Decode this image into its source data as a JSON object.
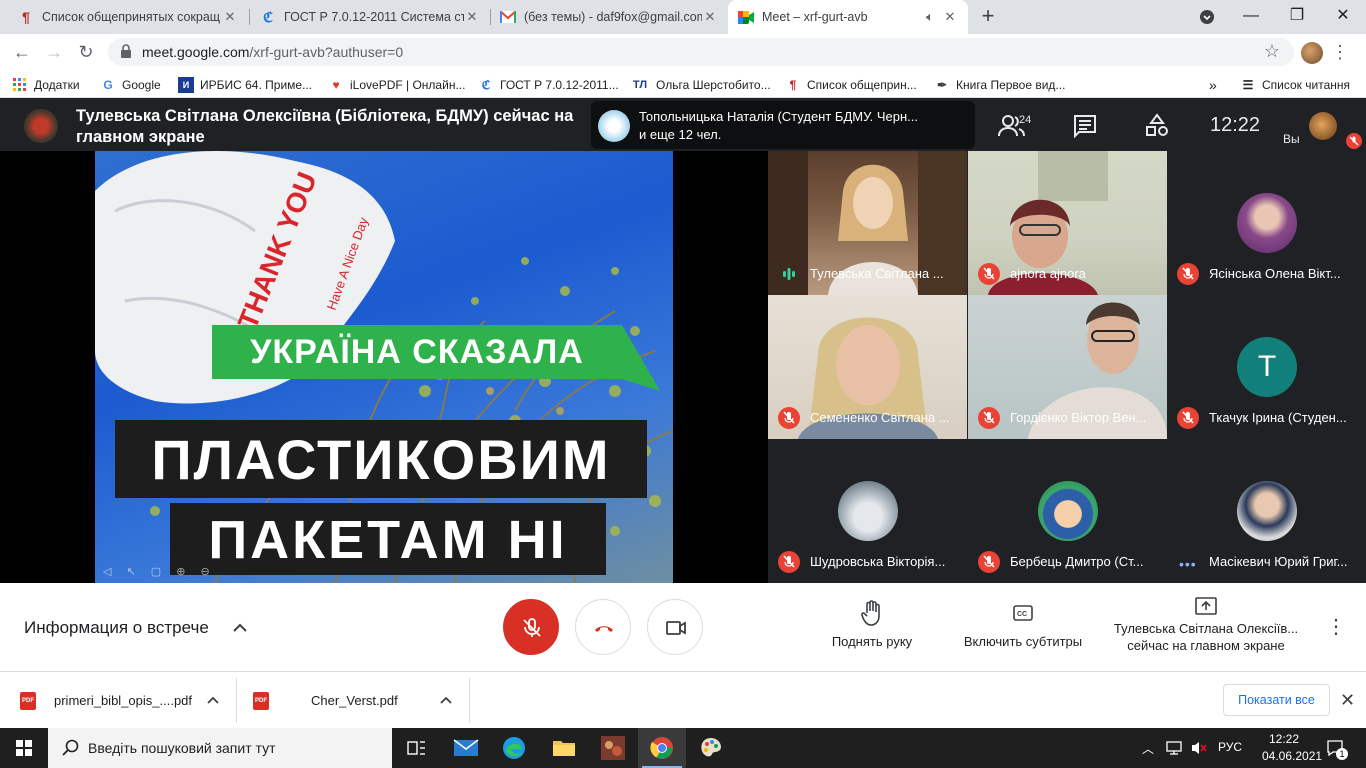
{
  "browser": {
    "tabs": [
      {
        "title": "Список общепринятых сокращ",
        "icon": "pilcrow-icon",
        "active": false
      },
      {
        "title": "ГОСТ Р 7.0.12-2011 Система ста",
        "icon": "gost-site-icon",
        "active": false
      },
      {
        "title": "(без темы) - daf9fox@gmail.com",
        "icon": "gmail-icon",
        "active": false
      },
      {
        "title": "Meet – xrf-gurt-avb",
        "icon": "meet-icon",
        "active": true
      }
    ],
    "url_main": "meet.google.com",
    "url_rest": "/xrf-gurt-avb?authuser=0",
    "bookmarks": [
      {
        "label": "Додатки",
        "icon": "apps-grid-icon"
      },
      {
        "label": "Google",
        "icon": "google-icon"
      },
      {
        "label": "ИРБИС 64. Приме...",
        "icon": "irbis-icon"
      },
      {
        "label": "iLovePDF | Онлайн...",
        "icon": "ilovepdf-icon"
      },
      {
        "label": "ГОСТ Р 7.0.12-2011...",
        "icon": "gost-site-icon"
      },
      {
        "label": "Ольга Шерстобито...",
        "icon": "tl-icon"
      },
      {
        "label": "Список общеприн...",
        "icon": "pilcrow-icon"
      },
      {
        "label": "Книга Первое вид...",
        "icon": "pen-icon"
      }
    ],
    "more_bookmarks": "»",
    "reading_list": "Список читання"
  },
  "meet": {
    "presenter_banner": "Тулевська Світлана Олексіївна (Бібліотека, БДМУ) сейчас на главном экране",
    "raised_hand_line1": "Топольницька Наталія (Студент БДМУ. Черн...",
    "raised_hand_line2": "и еще 12 чел.",
    "people_count": "24",
    "clock": "12:22",
    "self_label": "Вы",
    "slide": {
      "bag_text1": "THANK YOU",
      "bag_text2": "Have A Nice Day",
      "green": "УКРАЇНА СКАЗАЛА",
      "line1": "ПЛАСТИКОВИМ",
      "line2": "ПАКЕТАМ НІ"
    },
    "participants": [
      {
        "name": "Тулевська Світлана ...",
        "status": "speaking"
      },
      {
        "name": "ajnora ajnora",
        "status": "muted"
      },
      {
        "name": "Ясінська Олена Вікт...",
        "status": "muted"
      },
      {
        "name": "Семененко Світлана ...",
        "status": "muted"
      },
      {
        "name": "Гордієнко Віктор Вен...",
        "status": "muted"
      },
      {
        "name": "Ткачук Ірина (Студен...",
        "status": "muted",
        "letter": "T"
      },
      {
        "name": "Шудровська Вікторія...",
        "status": "muted"
      },
      {
        "name": "Бербець Дмитро (Ст...",
        "status": "muted"
      },
      {
        "name": "Масікевич Юрий Григ...",
        "status": "dots"
      }
    ],
    "controls": {
      "meeting_info": "Информация о встрече",
      "raise_hand": "Поднять руку",
      "captions": "Включить субтитры",
      "presenting_line1": "Тулевська Світлана Олексіїв...",
      "presenting_line2": "сейчас на главном экране"
    }
  },
  "downloads": {
    "items": [
      "primeri_bibl_opis_....pdf",
      "Cher_Verst.pdf"
    ],
    "show_all": "Показати все"
  },
  "taskbar": {
    "search_placeholder": "Введіть пошуковий запит тут",
    "lang": "РУС",
    "time": "12:22",
    "date": "04.06.2021",
    "notifications": "1"
  },
  "colors": {
    "meet_bg": "#202124",
    "mute_red": "#ea4335",
    "hangup_red": "#d93025",
    "banner_green": "#2fb24c",
    "accent_blue": "#1a73e8"
  }
}
